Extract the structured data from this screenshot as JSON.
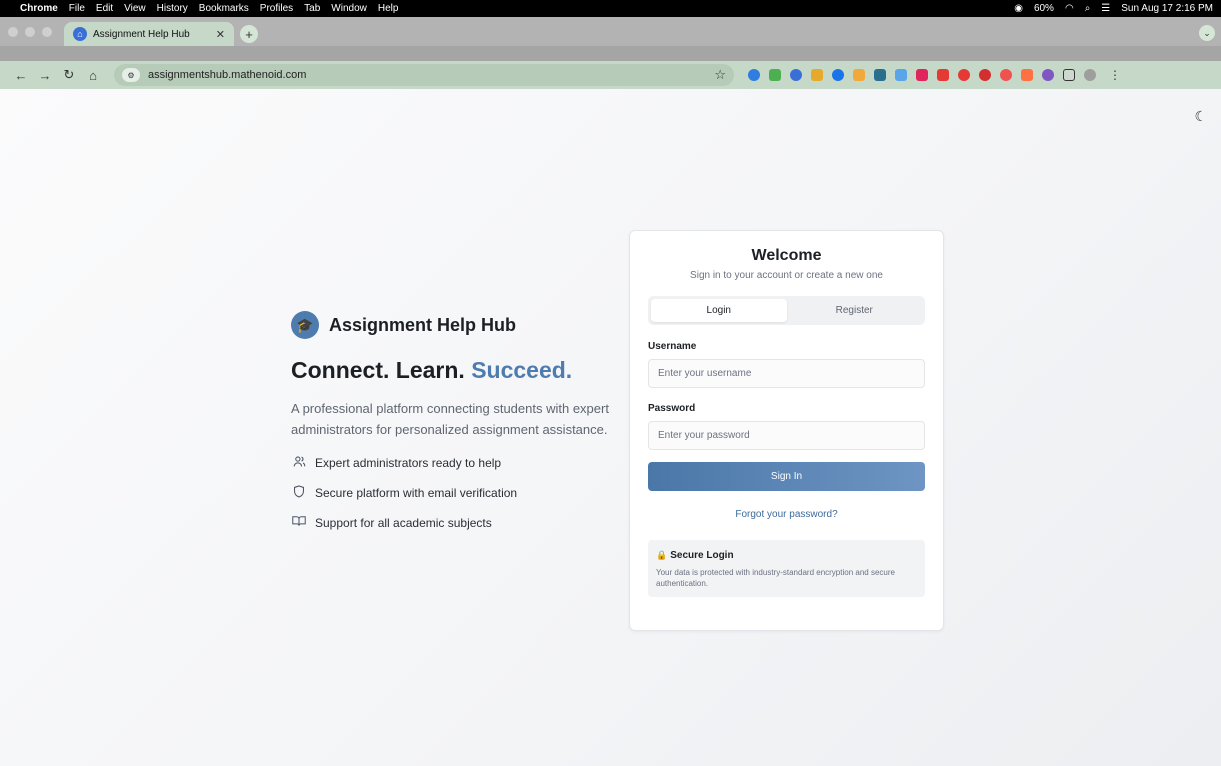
{
  "menubar": {
    "items": [
      "Chrome",
      "File",
      "Edit",
      "View",
      "History",
      "Bookmarks",
      "Profiles",
      "Tab",
      "Window",
      "Help"
    ],
    "battery": "60%",
    "datetime": "Sun Aug 17  2:16 PM"
  },
  "browser": {
    "tab_title": "Assignment Help Hub",
    "url": "assignmentshub.mathenoid.com"
  },
  "hero": {
    "brand_name": "Assignment Help Hub",
    "headline_part1": "Connect. Learn.",
    "headline_accent": "Succeed.",
    "tagline": "A professional platform connecting students with expert administrators for personalized assignment assistance.",
    "features": [
      {
        "icon": "users-icon",
        "text": "Expert administrators ready to help"
      },
      {
        "icon": "shield-icon",
        "text": "Secure platform with email verification"
      },
      {
        "icon": "book-open-icon",
        "text": "Support for all academic subjects"
      }
    ]
  },
  "card": {
    "title": "Welcome",
    "subtitle": "Sign in to your account or create a new one",
    "tabs": [
      {
        "label": "Login",
        "active": true
      },
      {
        "label": "Register",
        "active": false
      }
    ],
    "username_label": "Username",
    "username_placeholder": "Enter your username",
    "password_label": "Password",
    "password_placeholder": "Enter your password",
    "signin_label": "Sign In",
    "forgot_label": "Forgot your password?",
    "secure_title": "Secure Login",
    "secure_text": "Your data is protected with industry-standard encryption and secure authentication."
  },
  "colors": {
    "accent": "#4e7cae",
    "button_start": "#4a77a8",
    "button_end": "#6e95c3",
    "link": "#3d6a9c"
  }
}
